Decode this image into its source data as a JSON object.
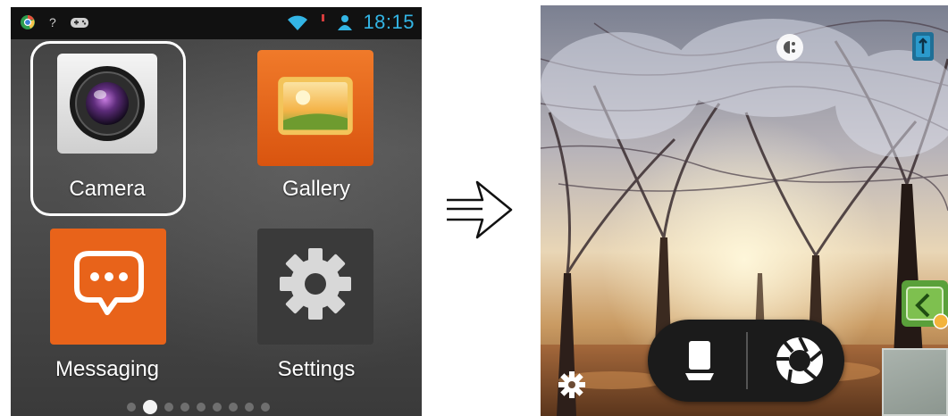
{
  "left_screen": {
    "status_bar": {
      "time": "18:15",
      "icons": [
        "chrome-icon",
        "question-icon",
        "gamepad-icon",
        "wifi-icon",
        "alert-icon",
        "signal-person-icon"
      ]
    },
    "apps": [
      {
        "label": "Camera",
        "icon": "camera-lens-icon",
        "highlighted": true
      },
      {
        "label": "Gallery",
        "icon": "gallery-picture-icon"
      },
      {
        "label": "Messaging",
        "icon": "speech-bubble-icon"
      },
      {
        "label": "Settings",
        "icon": "gear-icon"
      }
    ],
    "page_indicator": {
      "pages": 9,
      "current": 2
    },
    "colors": {
      "status_time": "#33b5e5",
      "app_orange": "#e8631a",
      "highlight": "#ffffff"
    }
  },
  "transition": {
    "icon": "right-arrow-icon"
  },
  "right_screen": {
    "camera_controls": {
      "top": [
        "flash-mode-icon",
        "switch-camera-icon"
      ],
      "bottom_bar": [
        "capture-mode-icon",
        "shutter-icon"
      ],
      "left_bottom": "settings-gear-icon",
      "right_side": [
        "effects-icon",
        "thumbnail-preview"
      ]
    }
  }
}
